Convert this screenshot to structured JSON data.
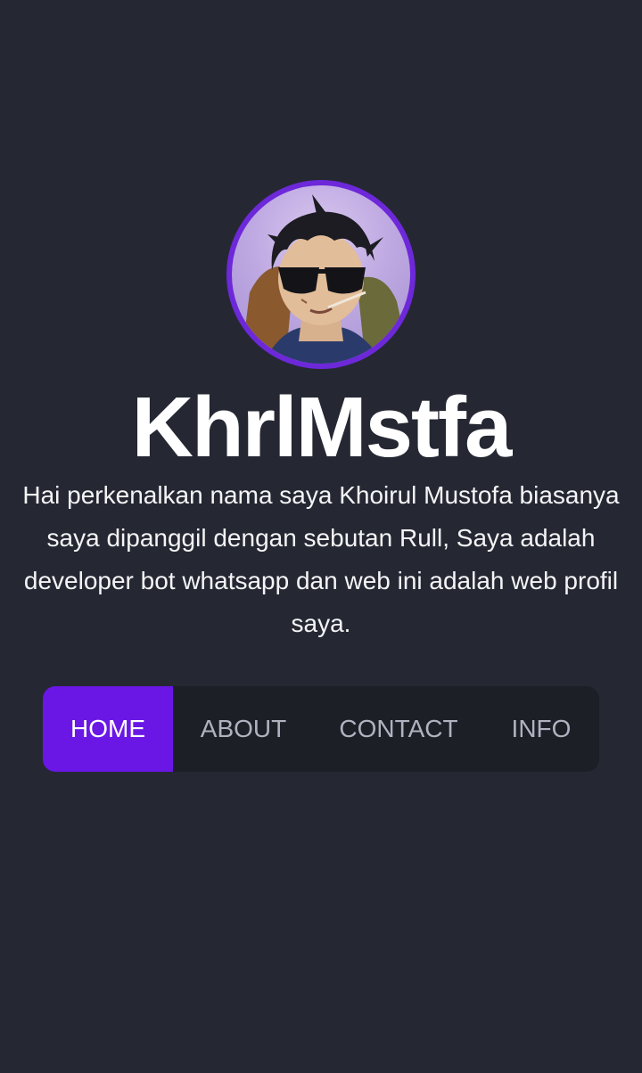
{
  "profile": {
    "name": "KhrlMstfa",
    "bio": "Hai perkenalkan nama saya Khoirul Mustofa biasanya saya dipanggil dengan sebutan Rull, Saya adalah developer bot whatsapp dan web ini adalah web profil saya."
  },
  "nav": {
    "items": [
      {
        "label": "HOME",
        "active": true
      },
      {
        "label": "ABOUT",
        "active": false
      },
      {
        "label": "CONTACT",
        "active": false
      },
      {
        "label": "INFO",
        "active": false
      }
    ]
  },
  "colors": {
    "background": "#252833",
    "nav_background": "#1d1f27",
    "accent": "#6a17e6",
    "avatar_ring": "#6d28d9",
    "inactive_text": "#aeb3bf"
  }
}
